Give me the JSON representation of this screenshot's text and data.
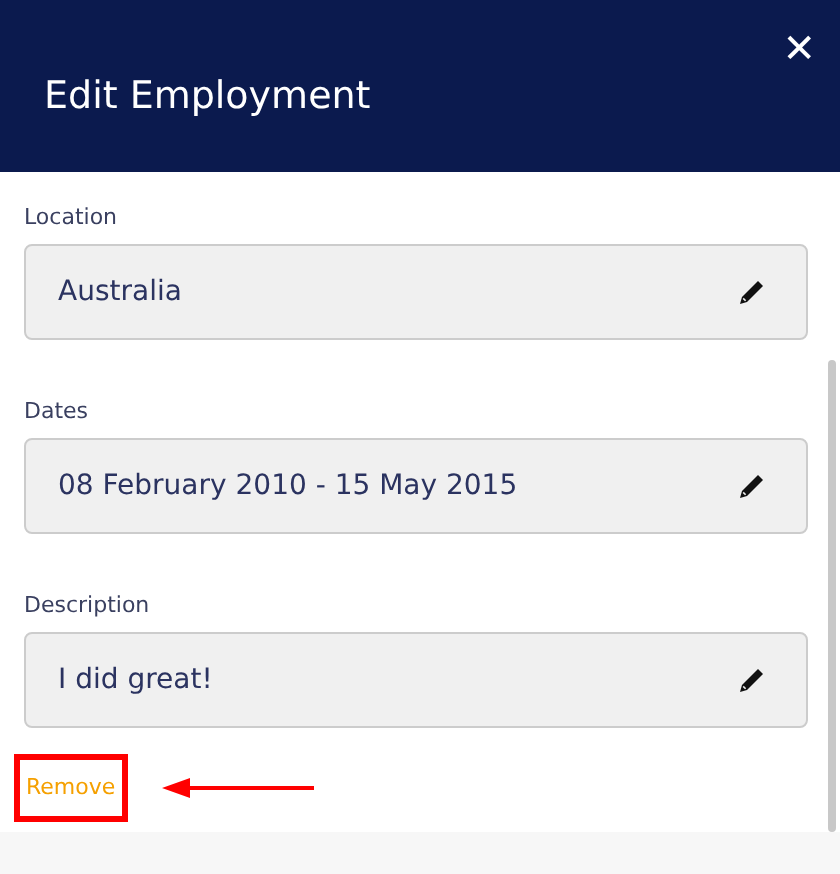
{
  "dialog": {
    "title": "Edit Employment",
    "close": "✕"
  },
  "fields": [
    {
      "label": "Location",
      "value": "Australia"
    },
    {
      "label": "Dates",
      "value": "08 February 2010 - 15 May 2015"
    },
    {
      "label": "Description",
      "value": "I did great!"
    }
  ],
  "remove_link": {
    "label": "Remove",
    "highlighted": true
  }
}
